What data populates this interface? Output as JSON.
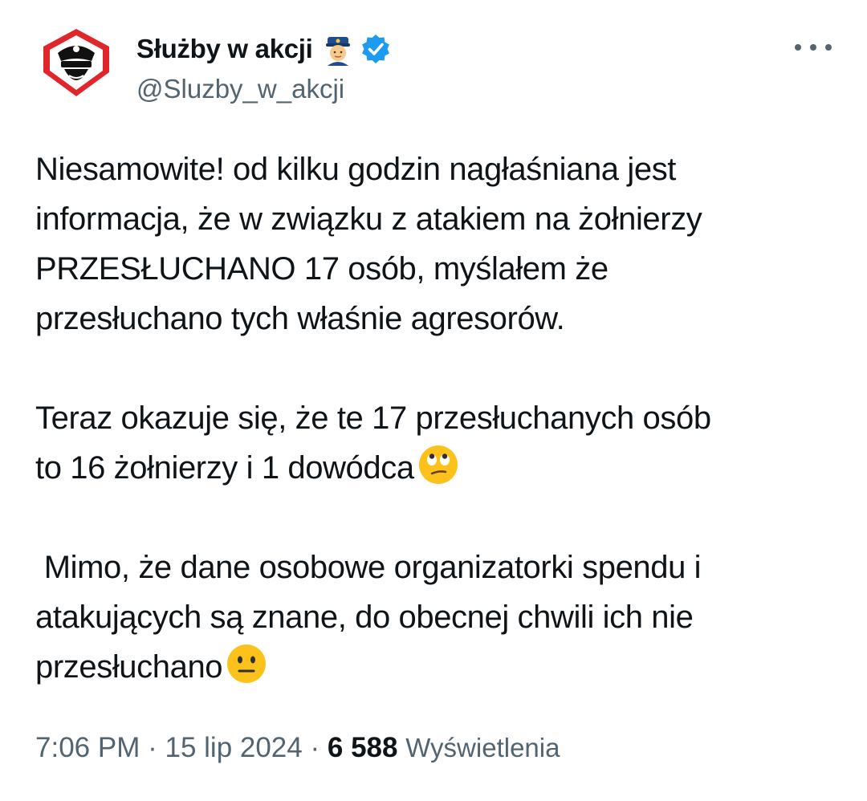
{
  "author": {
    "display_name": "Służby w akcji",
    "handle": "@Sluzby_w_akcji",
    "avatar_icon": "police-mask-avatar-icon",
    "officer_emoji": "police-officer-emoji",
    "verified_icon": "verified-badge-icon",
    "verified_color": "#1d9bf0",
    "avatar_color": "#e0262b"
  },
  "more_icon": "more-options-icon",
  "tweet": {
    "paragraph_1": "Niesamowite! od kilku godzin nagłaśniana jest\ninformacja, że w związku z atakiem na żołnierzy\nPRZESŁUCHANO 17 osób, myślałem że\nprzesłuchano tych właśnie agresorów.",
    "paragraph_2": "Teraz okazuje się, że te 17 przesłuchanych osób\nto 16 żołnierzy i 1 dowódca",
    "paragraph_2_emoji": "eye-roll-emoji",
    "paragraph_3": " Mimo, że dane osobowe organizatorki spendu i\natakujących są znane, do obecnej chwili ich nie\nprzesłuchano",
    "paragraph_3_emoji": "neutral-face-emoji"
  },
  "footer": {
    "time": "7:06 PM",
    "separator": "·",
    "date": "15 lip 2024",
    "views_count": "6 588",
    "views_label": "Wyświetlenia"
  }
}
